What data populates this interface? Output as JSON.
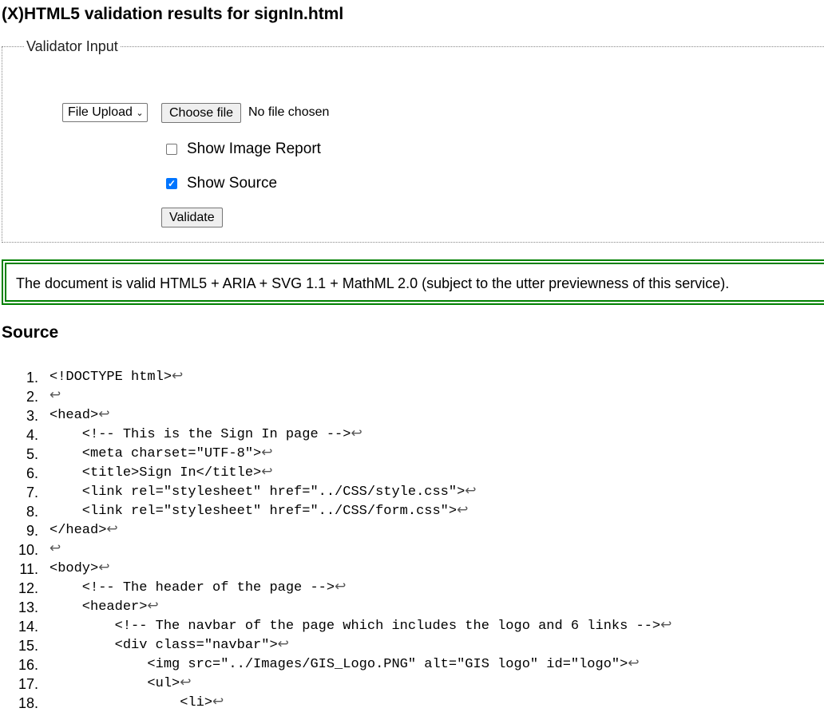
{
  "title": "(X)HTML5 validation results for signIn.html",
  "input": {
    "legend": "Validator Input",
    "mode_select": "File Upload",
    "choose_file_label": "Choose file",
    "file_status": "No file chosen",
    "show_image_report": {
      "label": "Show Image Report",
      "checked": false
    },
    "show_source": {
      "label": "Show Source",
      "checked": true
    },
    "validate_label": "Validate"
  },
  "result_message": "The document is valid HTML5 + ARIA + SVG 1.1 + MathML 2.0 (subject to the utter previewness of this service).",
  "colors": {
    "success_border": "#008000",
    "checkbox_accent": "#0075ff"
  },
  "source": {
    "heading": "Source",
    "line_end_symbol": "↩",
    "lines": [
      {
        "n": "1.",
        "code": "<!DOCTYPE html>"
      },
      {
        "n": "2.",
        "code": ""
      },
      {
        "n": "3.",
        "code": "<head>"
      },
      {
        "n": "4.",
        "code": "    <!-- This is the Sign In page -->"
      },
      {
        "n": "5.",
        "code": "    <meta charset=\"UTF-8\">"
      },
      {
        "n": "6.",
        "code": "    <title>Sign In</title>"
      },
      {
        "n": "7.",
        "code": "    <link rel=\"stylesheet\" href=\"../CSS/style.css\">"
      },
      {
        "n": "8.",
        "code": "    <link rel=\"stylesheet\" href=\"../CSS/form.css\">"
      },
      {
        "n": "9.",
        "code": "</head>"
      },
      {
        "n": "10.",
        "code": ""
      },
      {
        "n": "11.",
        "code": "<body>"
      },
      {
        "n": "12.",
        "code": "    <!-- The header of the page -->"
      },
      {
        "n": "13.",
        "code": "    <header>"
      },
      {
        "n": "14.",
        "code": "        <!-- The navbar of the page which includes the logo and 6 links -->"
      },
      {
        "n": "15.",
        "code": "        <div class=\"navbar\">"
      },
      {
        "n": "16.",
        "code": "            <img src=\"../Images/GIS_Logo.PNG\" alt=\"GIS logo\" id=\"logo\">"
      },
      {
        "n": "17.",
        "code": "            <ul>"
      },
      {
        "n": "18.",
        "code": "                <li>"
      }
    ]
  }
}
